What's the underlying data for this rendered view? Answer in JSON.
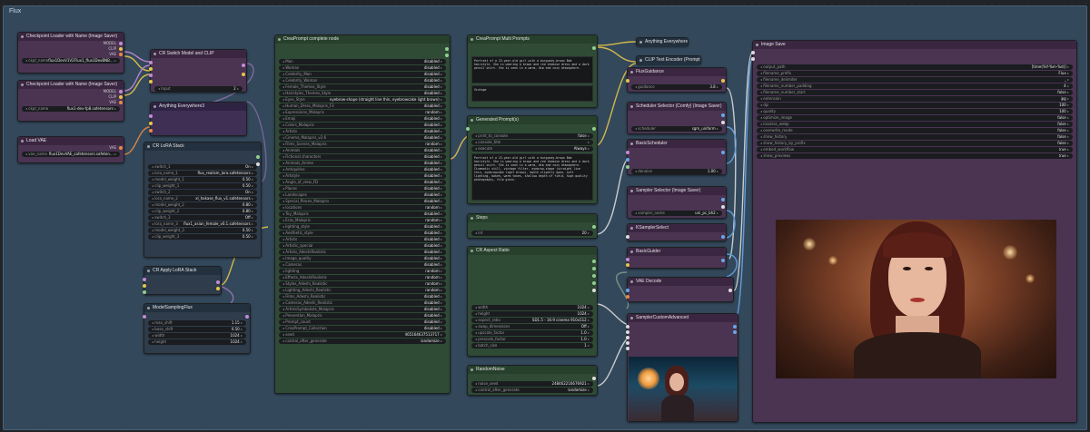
{
  "group_title": "Flux",
  "nodes": {
    "ckpt1": {
      "title": "Checkpoint Loader with Name (Image Saver)",
      "widgets": [
        {
          "k": "ckpt_name",
          "v": "flux1DevV1V2Flux1_flux1DevBNB..."
        }
      ]
    },
    "ckpt2": {
      "title": "Checkpoint Loader with Name (Image Saver)",
      "widgets": [
        {
          "k": "ckpt_name",
          "v": "flux1-dev-fp8.safetensors"
        }
      ]
    },
    "vae": {
      "title": "Load VAE",
      "widgets": [
        {
          "k": "vae_name",
          "v": "flux1DevVAE_safetensors.safeten..."
        }
      ]
    },
    "switch": {
      "title": "CR Switch Model and CLIP",
      "widgets": [
        {
          "k": "Input",
          "v": "2"
        }
      ]
    },
    "anything3": {
      "title": "Anything Everywhere3"
    },
    "lorastack": {
      "title": "CR LoRA Stack",
      "widgets": [
        {
          "k": "switch_1",
          "v": "On"
        },
        {
          "k": "lora_name_1",
          "v": "flux_realism_lora.safetensors"
        },
        {
          "k": "model_weight_1",
          "v": "0.50"
        },
        {
          "k": "clip_weight_1",
          "v": "0.50"
        },
        {
          "k": "switch_2",
          "v": "On"
        },
        {
          "k": "lora_name_2",
          "v": "xl_hakase_flux_v1.safetensors"
        },
        {
          "k": "model_weight_2",
          "v": "0.80"
        },
        {
          "k": "clip_weight_2",
          "v": "0.80"
        },
        {
          "k": "switch_3",
          "v": "Off"
        },
        {
          "k": "lora_name_3",
          "v": "flux1_asian_female_v0.1.safetensors"
        },
        {
          "k": "model_weight_3",
          "v": "0.50"
        },
        {
          "k": "clip_weight_3",
          "v": "0.50"
        }
      ]
    },
    "applylora": {
      "title": "CR Apply LoRA Stack"
    },
    "modelsampling": {
      "title": "ModelSamplingFlux",
      "widgets": [
        {
          "k": "max_shift",
          "v": "1.15"
        },
        {
          "k": "base_shift",
          "v": "0.50"
        },
        {
          "k": "width",
          "v": "1024"
        },
        {
          "k": "height",
          "v": "1024"
        }
      ]
    },
    "cpc": {
      "title": "CreaPrompt complete node",
      "widgets": [
        {
          "k": "Man",
          "v": "disabled"
        },
        {
          "k": "Woman",
          "v": "disabled"
        },
        {
          "k": "Celebrity_Man",
          "v": "disabled"
        },
        {
          "k": "Celebrity_Woman",
          "v": "disabled"
        },
        {
          "k": "Female_Themes_Style",
          "v": "disabled"
        },
        {
          "k": "Hairstyles_Themes_Style",
          "v": "disabled"
        },
        {
          "k": "Eyes_Style",
          "v": "eyebrow-shape (straight line thin, eyebrowcake light brown)"
        },
        {
          "k": "Human_Dress_Malapris_F3",
          "v": "disabled"
        },
        {
          "k": "Expressions_Malapris",
          "v": "random"
        },
        {
          "k": "Emoji",
          "v": "disabled"
        },
        {
          "k": "Colors_Malapris",
          "v": "disabled"
        },
        {
          "k": "Artists",
          "v": "disabled"
        },
        {
          "k": "Cinema_Malapris_v2.6",
          "v": "disabled"
        },
        {
          "k": "Films_Scenes_Malapris",
          "v": "random"
        },
        {
          "k": "Animals",
          "v": "disabled"
        },
        {
          "k": "Fictional characters",
          "v": "disabled"
        },
        {
          "k": "Animals_Anime",
          "v": "disabled"
        },
        {
          "k": "Antiquities",
          "v": "disabled"
        },
        {
          "k": "Artstyle",
          "v": "disabled"
        },
        {
          "k": "Angle_of_view_FD",
          "v": "disabled"
        },
        {
          "k": "Places",
          "v": "disabled"
        },
        {
          "k": "Landscapes",
          "v": "disabled"
        },
        {
          "k": "Special_Places_Malapris",
          "v": "disabled"
        },
        {
          "k": "locations",
          "v": "random"
        },
        {
          "k": "Toy_Malapris",
          "v": "disabled"
        },
        {
          "k": "Eras_Malapris",
          "v": "random"
        },
        {
          "k": "lighting_style",
          "v": "disabled"
        },
        {
          "k": "Aesthetic_style",
          "v": "disabled"
        },
        {
          "k": "Artists",
          "v": "disabled"
        },
        {
          "k": "Artistic_special",
          "v": "disabled"
        },
        {
          "k": "Artists_AdeshiRealistic",
          "v": "disabled"
        },
        {
          "k": "Image_quality",
          "v": "disabled"
        },
        {
          "k": "Cameras",
          "v": "disabled"
        },
        {
          "k": "lighting",
          "v": "random"
        },
        {
          "k": "Effects_AdeshiRealistic",
          "v": "random"
        },
        {
          "k": "Styles_Adeshi_Realistic",
          "v": "random"
        },
        {
          "k": "Lighting_Adeshi_Realistic",
          "v": "random"
        },
        {
          "k": "Films_Adeshi_Realistic",
          "v": "disabled"
        },
        {
          "k": "Cameras_Adeshi_Realistic",
          "v": "disabled"
        },
        {
          "k": "ArtistsSymbolists_Malapris",
          "v": "disabled"
        },
        {
          "k": "Prevention_Malapris",
          "v": "disabled"
        },
        {
          "k": "Prompt_count",
          "v": "disabled"
        },
        {
          "k": "CreaPrompt_Collection",
          "v": "disabled"
        },
        {
          "k": "seed",
          "v": "465164637513717"
        },
        {
          "k": "control_after_generate",
          "v": "randomize"
        }
      ]
    },
    "multi": {
      "title": "CreaPrompt Multi Prompts",
      "text1": "Portrait of a 23-year-old girl with a burgundy-brown Bob hairstyle. She is wearing a brown and red chemise dress and a dark pencil skirt. She is seen in a warm, dim and cozy atmosphere.",
      "text2": "Vintage"
    },
    "generated": {
      "title": "Generated Prompt(s)",
      "widgets": [
        {
          "k": "print_to_console",
          "v": "false"
        },
        {
          "k": "console_title",
          "v": ""
        },
        {
          "k": "execute",
          "v": "Always"
        }
      ],
      "text": "Portrait of a 23-year-old girl with a burgundy-brown Bob hairstyle. She is wearing a brown and red chemise dress and a dark pencil skirt. She is seen in a warm, dim and cozy atmosphere. Cinematic still, vintage filter, eyebrow-shape (straight line thin, eyebrowcake light brown), mouth slightly open, soft lighting, bokeh, warm tones, shallow depth of field, high quality photography, film grain."
    },
    "steps": {
      "title": "Steps",
      "widgets": [
        {
          "k": "int",
          "v": "20"
        }
      ]
    },
    "aspect": {
      "title": "CR Aspect Ratio",
      "widgets": [
        {
          "k": "width",
          "v": "1024"
        },
        {
          "k": "height",
          "v": "1024"
        },
        {
          "k": "aspect_ratio",
          "v": "SD1.5 - 16:9 cinema 910x512"
        },
        {
          "k": "swap_dimensions",
          "v": "Off"
        },
        {
          "k": "upscale_factor",
          "v": "1.0"
        },
        {
          "k": "prescale_factor",
          "v": "1.0"
        },
        {
          "k": "batch_size",
          "v": "1"
        }
      ]
    },
    "noise": {
      "title": "RandomNoise",
      "widgets": [
        {
          "k": "noise_seed",
          "v": "248462216676921"
        },
        {
          "k": "control_after_generate",
          "v": "randomize"
        }
      ]
    },
    "anything": {
      "title": "Anything Everywhere"
    },
    "clipenc": {
      "title": "CLIP Text Encoder (Prompt)"
    },
    "fluxguid": {
      "title": "FluxGuidance",
      "widgets": [
        {
          "k": "guidance",
          "v": "3.8"
        }
      ]
    },
    "schedsel": {
      "title": "Scheduler Selector (Comfy) (Image Saver)",
      "widgets": [
        {
          "k": "scheduler",
          "v": "sgm_uniform"
        }
      ]
    },
    "basicsched": {
      "title": "BasicScheduler",
      "widgets": [
        {
          "k": "denoise",
          "v": "1.00"
        }
      ]
    },
    "samplersel": {
      "title": "Sampler Selector (Image Saver)",
      "widgets": [
        {
          "k": "sampler_name",
          "v": "uni_pc_bh2"
        }
      ]
    },
    "ksamplersel": {
      "title": "KSamplerSelect"
    },
    "guider": {
      "title": "BasicGuider"
    },
    "vaedecode": {
      "title": "VAE Decode"
    },
    "sca": {
      "title": "SamplerCustomAdvanced"
    },
    "imagesave": {
      "title": "Image Save",
      "widgets": [
        {
          "k": "output_path",
          "v": "[time(%Y-%m-%d)]"
        },
        {
          "k": "filename_prefix",
          "v": "Flux"
        },
        {
          "k": "filename_delimiter",
          "v": "_"
        },
        {
          "k": "filename_number_padding",
          "v": "4"
        },
        {
          "k": "filename_number_start",
          "v": "false"
        },
        {
          "k": "extension",
          "v": "jpg"
        },
        {
          "k": "dpi",
          "v": "100"
        },
        {
          "k": "quality",
          "v": "100"
        },
        {
          "k": "optimize_image",
          "v": "false"
        },
        {
          "k": "lossless_webp",
          "v": "false"
        },
        {
          "k": "overwrite_mode",
          "v": "false"
        },
        {
          "k": "show_history",
          "v": "false"
        },
        {
          "k": "show_history_by_prefix",
          "v": "false"
        },
        {
          "k": "embed_workflow",
          "v": "true"
        },
        {
          "k": "show_previews",
          "v": "true"
        }
      ]
    }
  },
  "colors": {
    "group": "#33485b",
    "link_yellow": "#e6c64a",
    "link_blue": "#6aa6e8",
    "link_purple": "#c48ad8",
    "link_white": "#dcdcdc"
  }
}
